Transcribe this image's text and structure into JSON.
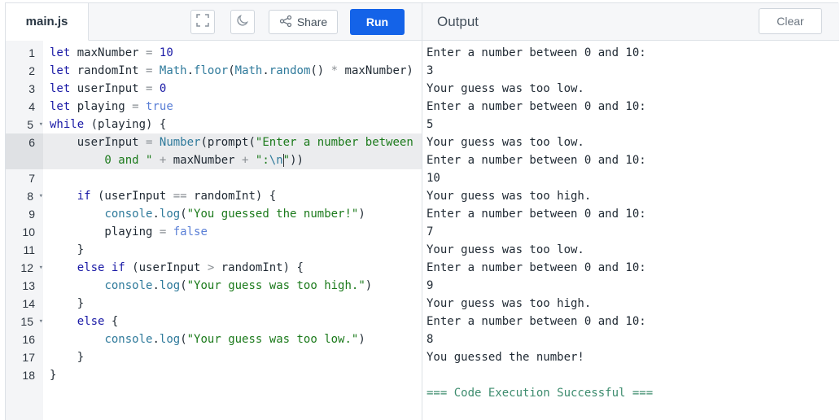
{
  "editor": {
    "file_tab": "main.js",
    "share_label": "Share",
    "run_label": "Run"
  },
  "output": {
    "title": "Output",
    "clear_label": "Clear",
    "lines": [
      "Enter a number between 0 and 10:",
      "3",
      "Your guess was too low.",
      "Enter a number between 0 and 10:",
      "5",
      "Your guess was too low.",
      "Enter a number between 0 and 10:",
      "10",
      "Your guess was too high.",
      "Enter a number between 0 and 10:",
      "7",
      "Your guess was too low.",
      "Enter a number between 0 and 10:",
      "9",
      "Your guess was too high.",
      "Enter a number between 0 and 10:",
      "8",
      "You guessed the number!",
      "",
      "=== Code Execution Successful ==="
    ]
  },
  "code": {
    "active_line": 6,
    "lines": [
      {
        "n": "1",
        "fold": false,
        "tokens": [
          [
            "kw",
            "let"
          ],
          [
            "",
            " maxNumber "
          ],
          [
            "op",
            "="
          ],
          [
            "",
            " "
          ],
          [
            "num",
            "10"
          ]
        ]
      },
      {
        "n": "2",
        "fold": false,
        "tokens": [
          [
            "kw",
            "let"
          ],
          [
            "",
            " randomInt "
          ],
          [
            "op",
            "="
          ],
          [
            "",
            " "
          ],
          [
            "fn",
            "Math"
          ],
          [
            "",
            "."
          ],
          [
            "fn",
            "floor"
          ],
          [
            "",
            "("
          ],
          [
            "fn",
            "Math"
          ],
          [
            "",
            "."
          ],
          [
            "fn",
            "random"
          ],
          [
            "",
            "() "
          ],
          [
            "op",
            "*"
          ],
          [
            "",
            " maxNumber)"
          ]
        ]
      },
      {
        "n": "3",
        "fold": false,
        "tokens": [
          [
            "kw",
            "let"
          ],
          [
            "",
            " userInput "
          ],
          [
            "op",
            "="
          ],
          [
            "",
            " "
          ],
          [
            "num",
            "0"
          ]
        ]
      },
      {
        "n": "4",
        "fold": false,
        "tokens": [
          [
            "kw",
            "let"
          ],
          [
            "",
            " playing "
          ],
          [
            "op",
            "="
          ],
          [
            "",
            " "
          ],
          [
            "bool",
            "true"
          ]
        ]
      },
      {
        "n": "5",
        "fold": true,
        "tokens": [
          [
            "kw",
            "while"
          ],
          [
            "",
            " (playing) {"
          ]
        ]
      },
      {
        "n": "6",
        "fold": false,
        "tokens": [
          [
            "",
            "    userInput "
          ],
          [
            "op",
            "="
          ],
          [
            "",
            " "
          ],
          [
            "fn",
            "Number"
          ],
          [
            "",
            "(prompt("
          ],
          [
            "str",
            "\"Enter a number between"
          ]
        ]
      },
      {
        "n": "",
        "fold": false,
        "tokens": [
          [
            "str",
            "        0 and \""
          ],
          [
            "",
            " "
          ],
          [
            "op",
            "+"
          ],
          [
            "",
            " maxNumber "
          ],
          [
            "op",
            "+"
          ],
          [
            "",
            " "
          ],
          [
            "str",
            "\":"
          ],
          [
            "esc",
            "\\n"
          ],
          [
            "cursor",
            ""
          ],
          [
            "str",
            "\""
          ],
          [
            "",
            "))"
          ]
        ]
      },
      {
        "n": "7",
        "fold": false,
        "tokens": []
      },
      {
        "n": "8",
        "fold": true,
        "tokens": [
          [
            "",
            "    "
          ],
          [
            "kw",
            "if"
          ],
          [
            "",
            " (userInput "
          ],
          [
            "op",
            "=="
          ],
          [
            "",
            " randomInt) {"
          ]
        ]
      },
      {
        "n": "9",
        "fold": false,
        "tokens": [
          [
            "",
            "        "
          ],
          [
            "fn",
            "console"
          ],
          [
            "",
            "."
          ],
          [
            "fn",
            "log"
          ],
          [
            "",
            "("
          ],
          [
            "str",
            "\"You guessed the number!\""
          ],
          [
            "",
            ")"
          ]
        ]
      },
      {
        "n": "10",
        "fold": false,
        "tokens": [
          [
            "",
            "        playing "
          ],
          [
            "op",
            "="
          ],
          [
            "",
            " "
          ],
          [
            "bool",
            "false"
          ]
        ]
      },
      {
        "n": "11",
        "fold": false,
        "tokens": [
          [
            "",
            "    }"
          ]
        ]
      },
      {
        "n": "12",
        "fold": true,
        "tokens": [
          [
            "",
            "    "
          ],
          [
            "kw",
            "else"
          ],
          [
            "",
            " "
          ],
          [
            "kw",
            "if"
          ],
          [
            "",
            " (userInput "
          ],
          [
            "op",
            ">"
          ],
          [
            "",
            " randomInt) {"
          ]
        ]
      },
      {
        "n": "13",
        "fold": false,
        "tokens": [
          [
            "",
            "        "
          ],
          [
            "fn",
            "console"
          ],
          [
            "",
            "."
          ],
          [
            "fn",
            "log"
          ],
          [
            "",
            "("
          ],
          [
            "str",
            "\"Your guess was too high.\""
          ],
          [
            "",
            ")"
          ]
        ]
      },
      {
        "n": "14",
        "fold": false,
        "tokens": [
          [
            "",
            "    }"
          ]
        ]
      },
      {
        "n": "15",
        "fold": true,
        "tokens": [
          [
            "",
            "    "
          ],
          [
            "kw",
            "else"
          ],
          [
            "",
            " {"
          ]
        ]
      },
      {
        "n": "16",
        "fold": false,
        "tokens": [
          [
            "",
            "        "
          ],
          [
            "fn",
            "console"
          ],
          [
            "",
            "."
          ],
          [
            "fn",
            "log"
          ],
          [
            "",
            "("
          ],
          [
            "str",
            "\"Your guess was too low.\""
          ],
          [
            "",
            ")"
          ]
        ]
      },
      {
        "n": "17",
        "fold": false,
        "tokens": [
          [
            "",
            "    }"
          ]
        ]
      },
      {
        "n": "18",
        "fold": false,
        "tokens": [
          [
            "",
            "}"
          ]
        ]
      }
    ]
  },
  "icons": {
    "fullscreen": "fullscreen-icon",
    "theme": "moon-icon",
    "share": "share-icon",
    "fold": "fold-arrow-icon"
  }
}
